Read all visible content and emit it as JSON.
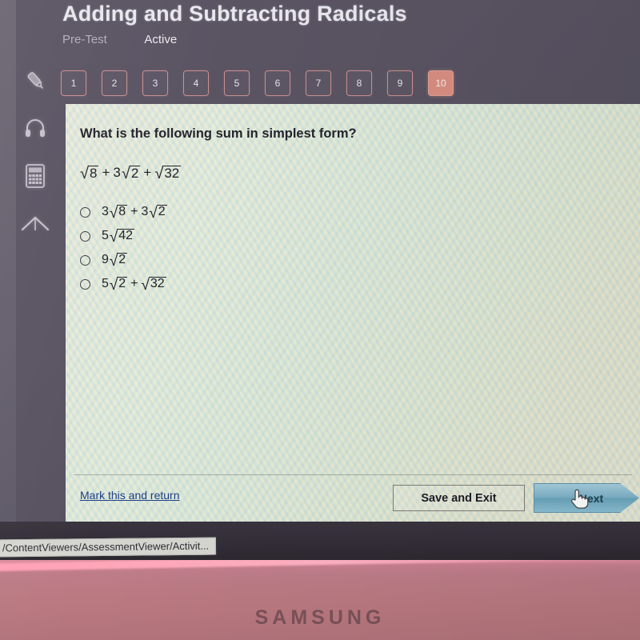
{
  "device": {
    "brand": "SAMSUNG"
  },
  "browser": {
    "status_url": "/ContentViewers/AssessmentViewer/Activit..."
  },
  "header": {
    "title": "Adding and Subtracting Radicals",
    "test_type": "Pre-Test",
    "status": "Active"
  },
  "question_nav": {
    "items": [
      {
        "label": "1",
        "current": false
      },
      {
        "label": "2",
        "current": false
      },
      {
        "label": "3",
        "current": false
      },
      {
        "label": "4",
        "current": false
      },
      {
        "label": "5",
        "current": false
      },
      {
        "label": "6",
        "current": false
      },
      {
        "label": "7",
        "current": false
      },
      {
        "label": "8",
        "current": false
      },
      {
        "label": "9",
        "current": false
      },
      {
        "label": "10",
        "current": true
      }
    ],
    "current_question": "10",
    "current_color": "#d78d82"
  },
  "toolbar": {
    "items": [
      {
        "icon": "highlighter-icon"
      },
      {
        "icon": "headphones-icon"
      },
      {
        "icon": "calculator-icon"
      },
      {
        "icon": "up-arrow-icon"
      }
    ]
  },
  "question": {
    "prompt": "What is the following sum in simplest form?",
    "expression": {
      "terms": [
        {
          "coefficient": "",
          "radicand": "8"
        },
        {
          "coefficient": "3",
          "radicand": "2"
        },
        {
          "coefficient": "",
          "radicand": "32"
        }
      ],
      "operator": "+",
      "plain": "√8 + 3√2 + √32"
    },
    "options": [
      {
        "id": "a",
        "selected": false,
        "plain": "3√8 + 3√2",
        "terms": [
          {
            "coefficient": "3",
            "radicand": "8"
          },
          {
            "coefficient": "3",
            "radicand": "2"
          }
        ],
        "operator": "+"
      },
      {
        "id": "b",
        "selected": false,
        "plain": "5√42",
        "terms": [
          {
            "coefficient": "5",
            "radicand": "42"
          }
        ],
        "operator": ""
      },
      {
        "id": "c",
        "selected": false,
        "plain": "9√2",
        "terms": [
          {
            "coefficient": "9",
            "radicand": "2"
          }
        ],
        "operator": ""
      },
      {
        "id": "d",
        "selected": false,
        "plain": "5√2 + √32",
        "terms": [
          {
            "coefficient": "5",
            "radicand": "2"
          },
          {
            "coefficient": "",
            "radicand": "32"
          }
        ],
        "operator": "+"
      }
    ]
  },
  "footer": {
    "mark_link": "Mark this and return",
    "save_label": "Save and Exit",
    "next_label": "Next",
    "next_color": "#7db2c8"
  }
}
